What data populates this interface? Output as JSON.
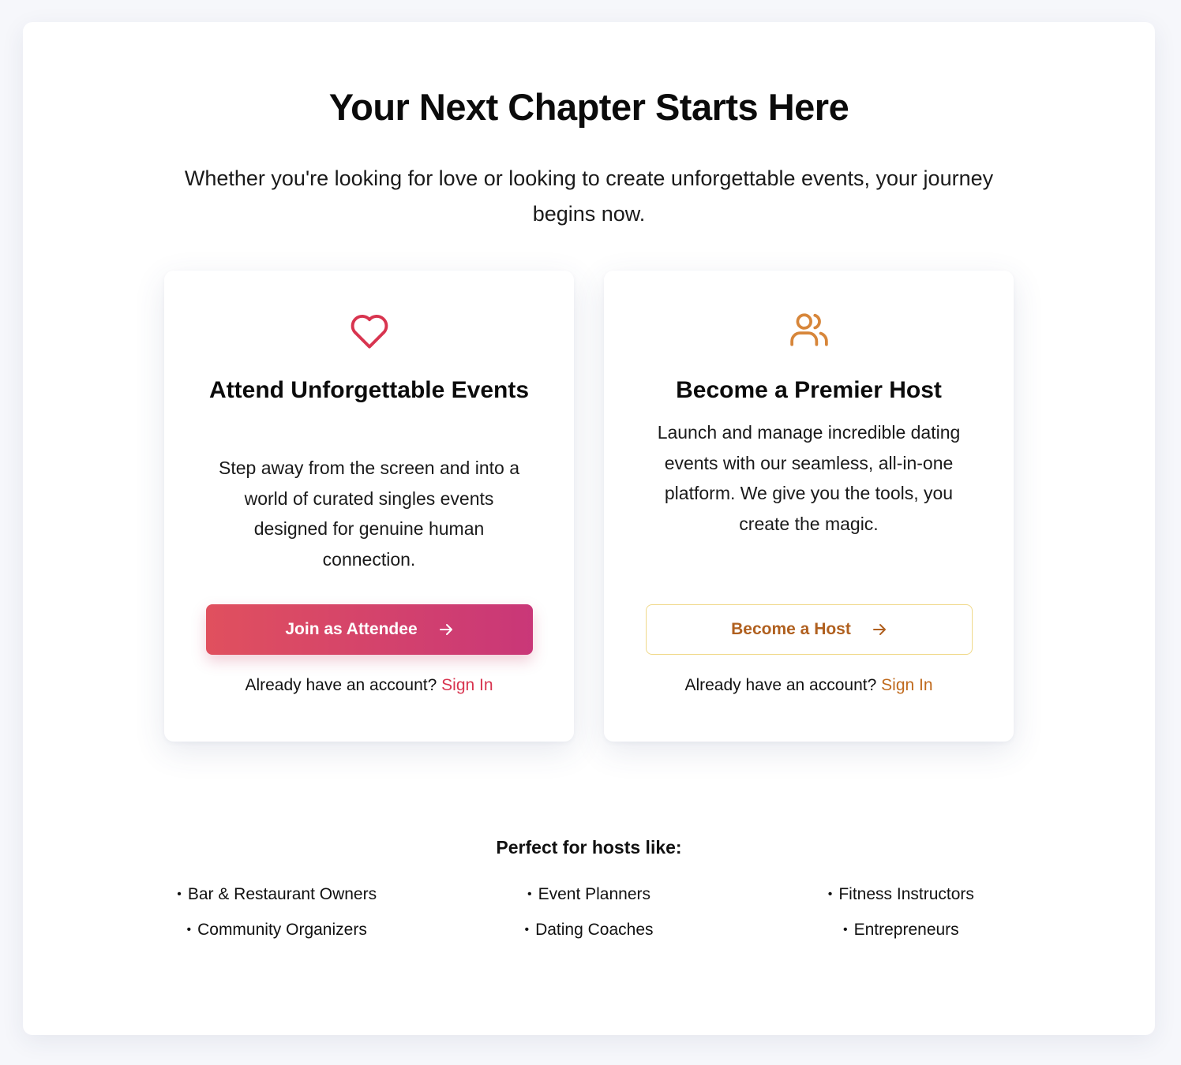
{
  "hero": {
    "title": "Your Next Chapter Starts Here",
    "subtitle": "Whether you're looking for love or looking to create unforgettable events, your journey begins now."
  },
  "attendee_card": {
    "icon": "heart-icon",
    "title": "Attend Unforgettable Events",
    "description": "Step away from the screen and into a world of curated singles events designed for genuine human connection.",
    "button_label": "Join as Attendee",
    "signin_prompt": "Already have an account?",
    "signin_link": "Sign In"
  },
  "host_card": {
    "icon": "users-icon",
    "title": "Become a Premier Host",
    "description": "Launch and manage incredible dating events with our seamless, all-in-one platform. We give you the tools, you create the magic.",
    "button_label": "Become a Host",
    "signin_prompt": "Already have an account?",
    "signin_link": "Sign In"
  },
  "hosts_section": {
    "title": "Perfect for hosts like:",
    "items": [
      "Bar & Restaurant Owners",
      "Event Planners",
      "Fitness Instructors",
      "Community Organizers",
      "Dating Coaches",
      "Entrepreneurs"
    ]
  },
  "colors": {
    "attendee_accent": "#d8344f",
    "attendee_gradient_start": "#e0505e",
    "attendee_gradient_end": "#c93778",
    "host_accent": "#c06a1d",
    "host_border": "#f0d98a"
  }
}
